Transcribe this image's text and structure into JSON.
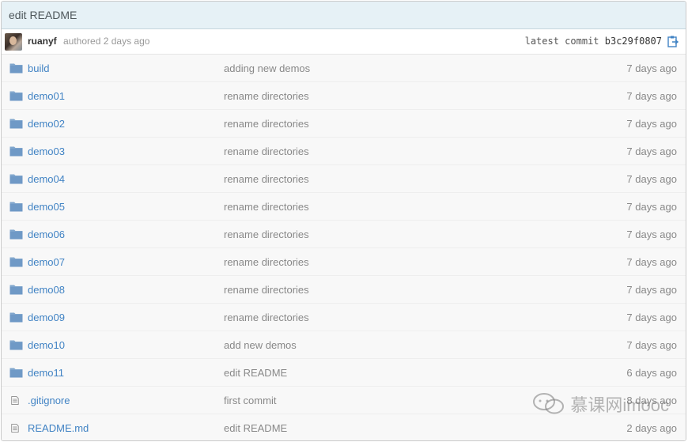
{
  "commit": {
    "message": "edit README",
    "author": "ruanyf",
    "authored_text": "authored 2 days ago",
    "latest_label": "latest commit",
    "sha": "b3c29f0807"
  },
  "files": [
    {
      "name": "build",
      "type": "folder",
      "message": "adding new demos",
      "age": "7 days ago"
    },
    {
      "name": "demo01",
      "type": "folder",
      "message": "rename directories",
      "age": "7 days ago"
    },
    {
      "name": "demo02",
      "type": "folder",
      "message": "rename directories",
      "age": "7 days ago"
    },
    {
      "name": "demo03",
      "type": "folder",
      "message": "rename directories",
      "age": "7 days ago"
    },
    {
      "name": "demo04",
      "type": "folder",
      "message": "rename directories",
      "age": "7 days ago"
    },
    {
      "name": "demo05",
      "type": "folder",
      "message": "rename directories",
      "age": "7 days ago"
    },
    {
      "name": "demo06",
      "type": "folder",
      "message": "rename directories",
      "age": "7 days ago"
    },
    {
      "name": "demo07",
      "type": "folder",
      "message": "rename directories",
      "age": "7 days ago"
    },
    {
      "name": "demo08",
      "type": "folder",
      "message": "rename directories",
      "age": "7 days ago"
    },
    {
      "name": "demo09",
      "type": "folder",
      "message": "rename directories",
      "age": "7 days ago"
    },
    {
      "name": "demo10",
      "type": "folder",
      "message": "add new demos",
      "age": "7 days ago"
    },
    {
      "name": "demo11",
      "type": "folder",
      "message": "edit README",
      "age": "6 days ago"
    },
    {
      "name": ".gitignore",
      "type": "file",
      "message": "first commit",
      "age": "8 days ago"
    },
    {
      "name": "README.md",
      "type": "file",
      "message": "edit README",
      "age": "2 days ago"
    }
  ],
  "watermark": {
    "text": "慕课网imooc"
  },
  "colors": {
    "link": "#4183c4",
    "folder_icon": "#80a6cd",
    "header_bg": "#e6f1f6"
  }
}
